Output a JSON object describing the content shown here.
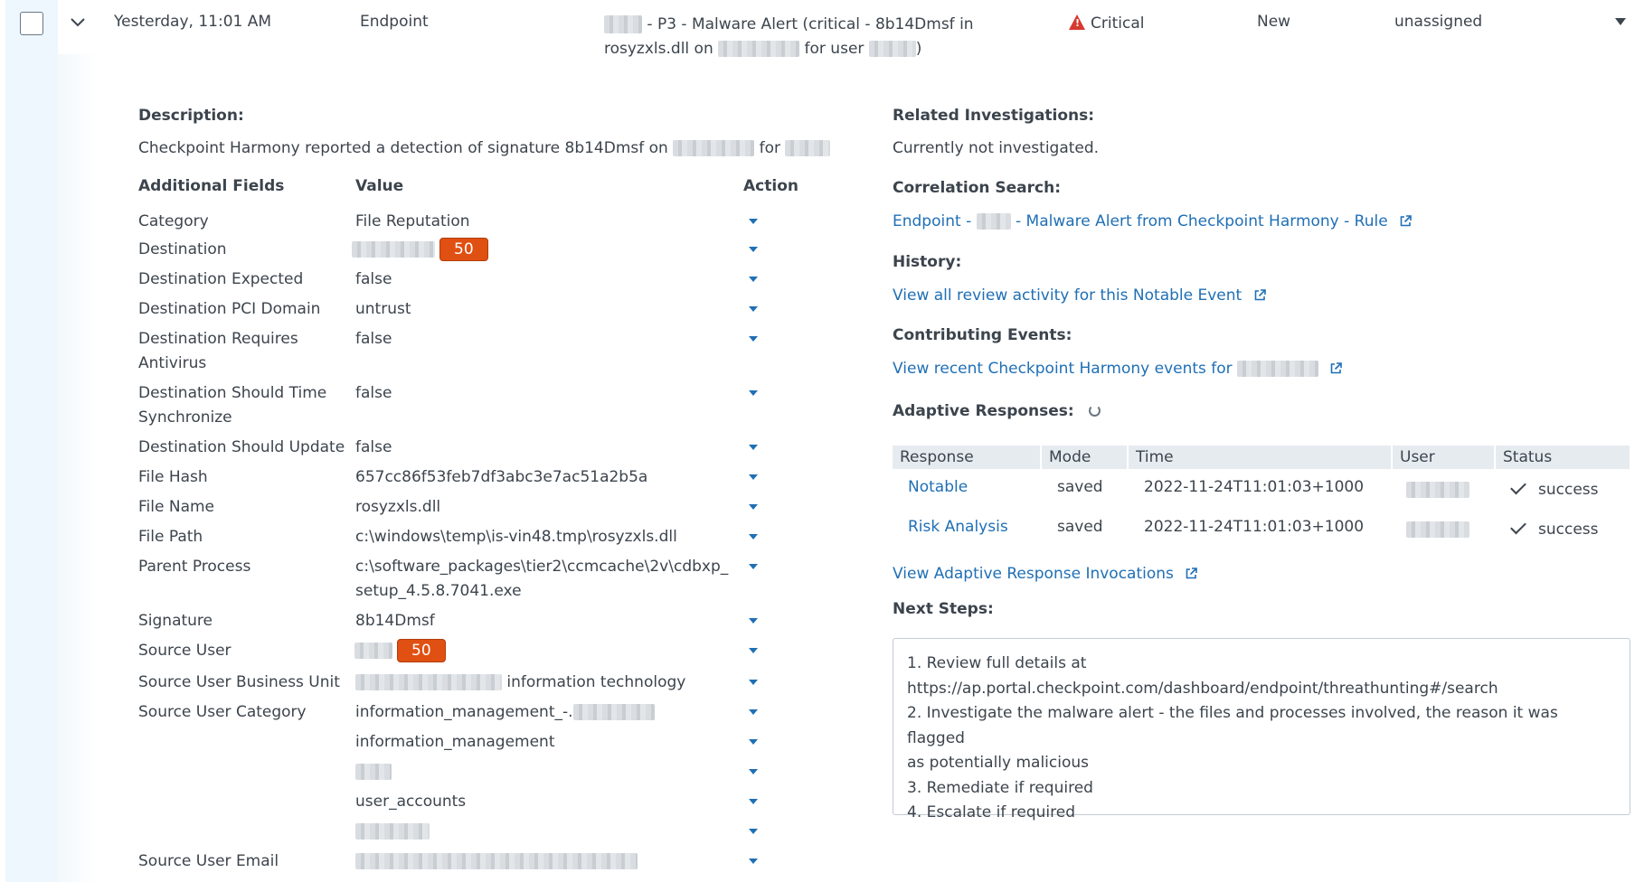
{
  "event": {
    "time": "Yesterday, 11:01 AM",
    "domain": "Endpoint",
    "title_part1": "- P3 - Malware Alert (critical - 8b14Dmsf in",
    "title_part2_a": "rosyzxls.dll on",
    "title_part2_b": "for user",
    "title_part2_c": ")",
    "urgency": "Critical",
    "status": "New",
    "owner": "unassigned"
  },
  "description": {
    "heading": "Description:",
    "text_a": "Checkpoint Harmony reported a detection of signature 8b14Dmsf on",
    "text_b": "for"
  },
  "fields": {
    "headers": {
      "field": "Additional Fields",
      "value": "Value",
      "action": "Action"
    },
    "rows": [
      {
        "label": "Category",
        "value": "File Reputation"
      },
      {
        "label": "Destination",
        "value": "",
        "risk": "50"
      },
      {
        "label": "Destination Expected",
        "value": "false"
      },
      {
        "label": "Destination PCI Domain",
        "value": "untrust"
      },
      {
        "label": "Destination Requires Antivirus",
        "value": "false"
      },
      {
        "label": "Destination Should Time Synchronize",
        "value": "false"
      },
      {
        "label": "Destination Should Update",
        "value": "false"
      },
      {
        "label": "File Hash",
        "value": "657cc86f53feb7df3abc3e7ac51a2b5a"
      },
      {
        "label": "File Name",
        "value": "rosyzxls.dll"
      },
      {
        "label": "File Path",
        "value": "c:\\windows\\temp\\is-vin48.tmp\\rosyzxls.dll"
      },
      {
        "label": "Parent Process",
        "value": "c:\\software_packages\\tier2\\ccmcache\\2v\\cdbxp_setup_4.5.8.7041.exe"
      },
      {
        "label": "Signature",
        "value": "8b14Dmsf"
      },
      {
        "label": "Source User",
        "value": "",
        "risk": "50"
      },
      {
        "label": "Source User Business Unit",
        "value": "information technology"
      },
      {
        "label": "Source User Category",
        "value": "information_management_-."
      },
      {
        "label": "",
        "value": "information_management"
      },
      {
        "label": "",
        "value": ""
      },
      {
        "label": "",
        "value": "user_accounts"
      },
      {
        "label": "",
        "value": ""
      },
      {
        "label": "Source User Email",
        "value": ""
      }
    ]
  },
  "related": {
    "heading": "Related Investigations:",
    "text": "Currently not investigated."
  },
  "correlation": {
    "heading": "Correlation Search:",
    "link_a": "Endpoint -",
    "link_b": "- Malware Alert from Checkpoint Harmony - Rule"
  },
  "history": {
    "heading": "History:",
    "link": "View all review activity for this Notable Event"
  },
  "contributing": {
    "heading": "Contributing Events:",
    "link": "View recent Checkpoint Harmony events for"
  },
  "adaptive": {
    "heading": "Adaptive Responses:",
    "columns": [
      "Response",
      "Mode",
      "Time",
      "User",
      "Status"
    ],
    "rows": [
      {
        "response": "Notable",
        "mode": "saved",
        "time": "2022-11-24T11:01:03+1000",
        "status": "success"
      },
      {
        "response": "Risk Analysis",
        "mode": "saved",
        "time": "2022-11-24T11:01:03+1000",
        "status": "success"
      }
    ],
    "invocations_link": "View Adaptive Response Invocations"
  },
  "next_steps": {
    "heading": "Next Steps:",
    "lines": [
      "1. Review full details at",
      "https://ap.portal.checkpoint.com/dashboard/endpoint/threathunting#/search",
      "2. Investigate the malware alert - the files and processes involved, the reason it was flagged",
      "as potentially malicious",
      "3. Remediate if required",
      "4. Escalate if required"
    ]
  },
  "colors": {
    "link": "#1f6fb5",
    "risk_badge": "#e05012",
    "critical": "#d6392f",
    "left_strip": "#eef7fd"
  }
}
